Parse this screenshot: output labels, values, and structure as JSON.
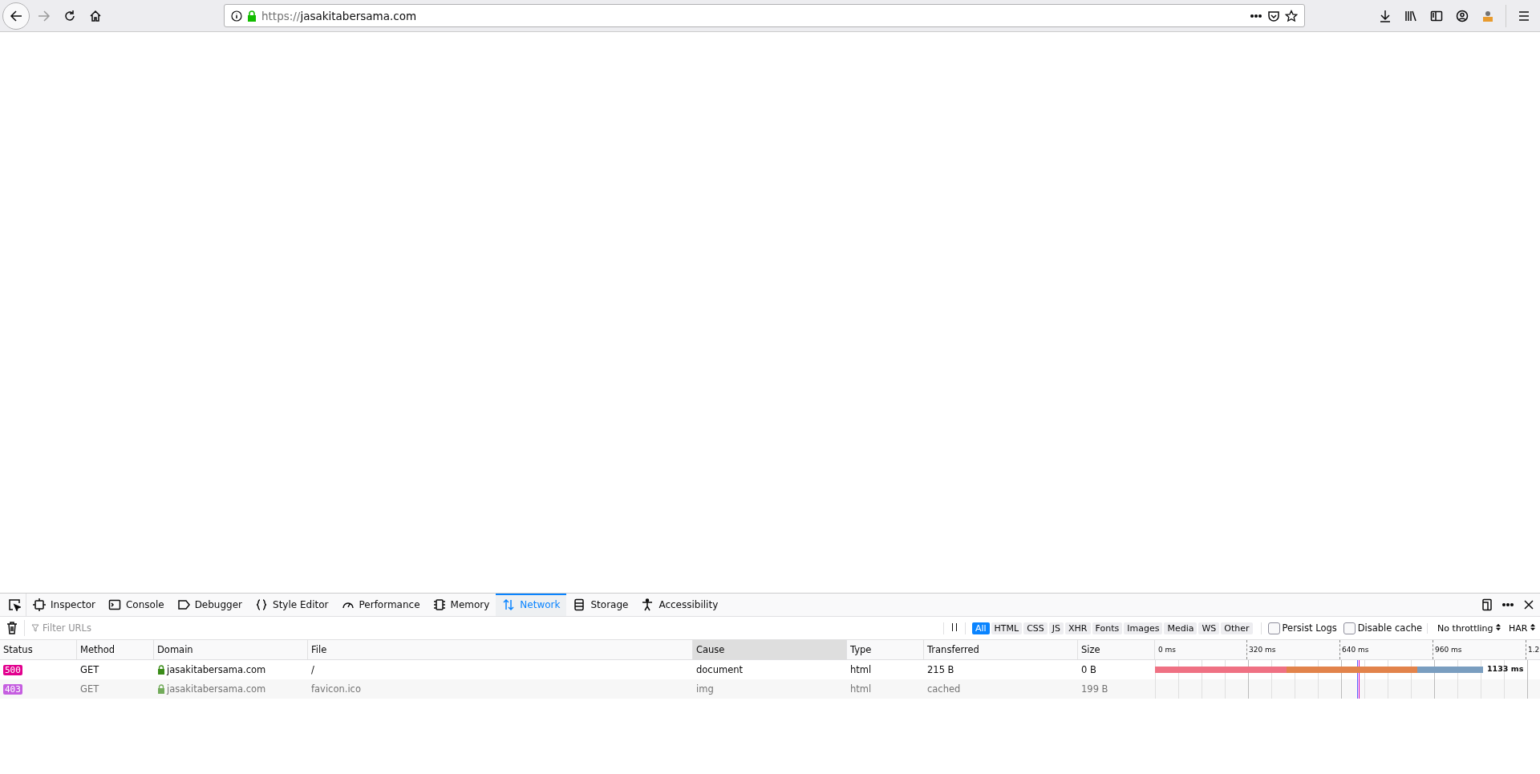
{
  "browser": {
    "url_scheme": "https://",
    "url_host": "jasakitabersama.com"
  },
  "devtools": {
    "tabs": [
      {
        "label": "Inspector",
        "selected": false
      },
      {
        "label": "Console",
        "selected": false
      },
      {
        "label": "Debugger",
        "selected": false
      },
      {
        "label": "Style Editor",
        "selected": false
      },
      {
        "label": "Performance",
        "selected": false
      },
      {
        "label": "Memory",
        "selected": false
      },
      {
        "label": "Network",
        "selected": true
      },
      {
        "label": "Storage",
        "selected": false
      },
      {
        "label": "Accessibility",
        "selected": false
      }
    ]
  },
  "network": {
    "filter_placeholder": "Filter URLs",
    "type_filters": [
      {
        "label": "All",
        "selected": true
      },
      {
        "label": "HTML",
        "selected": false
      },
      {
        "label": "CSS",
        "selected": false
      },
      {
        "label": "JS",
        "selected": false
      },
      {
        "label": "XHR",
        "selected": false
      },
      {
        "label": "Fonts",
        "selected": false
      },
      {
        "label": "Images",
        "selected": false
      },
      {
        "label": "Media",
        "selected": false
      },
      {
        "label": "WS",
        "selected": false
      },
      {
        "label": "Other",
        "selected": false
      }
    ],
    "options": [
      {
        "label": "Persist Logs",
        "checked": false
      },
      {
        "label": "Disable cache",
        "checked": false
      }
    ],
    "throttling": "No throttling",
    "har": "HAR",
    "columns": [
      {
        "label": "Status",
        "selected": false
      },
      {
        "label": "Method",
        "selected": false
      },
      {
        "label": "Domain",
        "selected": false
      },
      {
        "label": "File",
        "selected": false
      },
      {
        "label": "Cause",
        "selected": true
      },
      {
        "label": "Type",
        "selected": false
      },
      {
        "label": "Transferred",
        "selected": false
      },
      {
        "label": "Size",
        "selected": false
      }
    ],
    "timeline_ticks": [
      "0 ms",
      "320 ms",
      "640 ms",
      "960 ms",
      "1.2"
    ],
    "rows": [
      {
        "status": "500",
        "color": "#e2008e",
        "method": "GET",
        "domain": "jasakitabersama.com",
        "file": "/",
        "cause": "document",
        "type": "html",
        "transferred": "215 B",
        "size": "0 B",
        "total_time": "1133 ms",
        "cached": false
      },
      {
        "status": "403",
        "color": "#c55ee0",
        "method": "GET",
        "domain": "jasakitabersama.com",
        "file": "favicon.ico",
        "cause": "img",
        "type": "html",
        "transferred": "cached",
        "size": "199 B",
        "cached": true
      }
    ]
  }
}
